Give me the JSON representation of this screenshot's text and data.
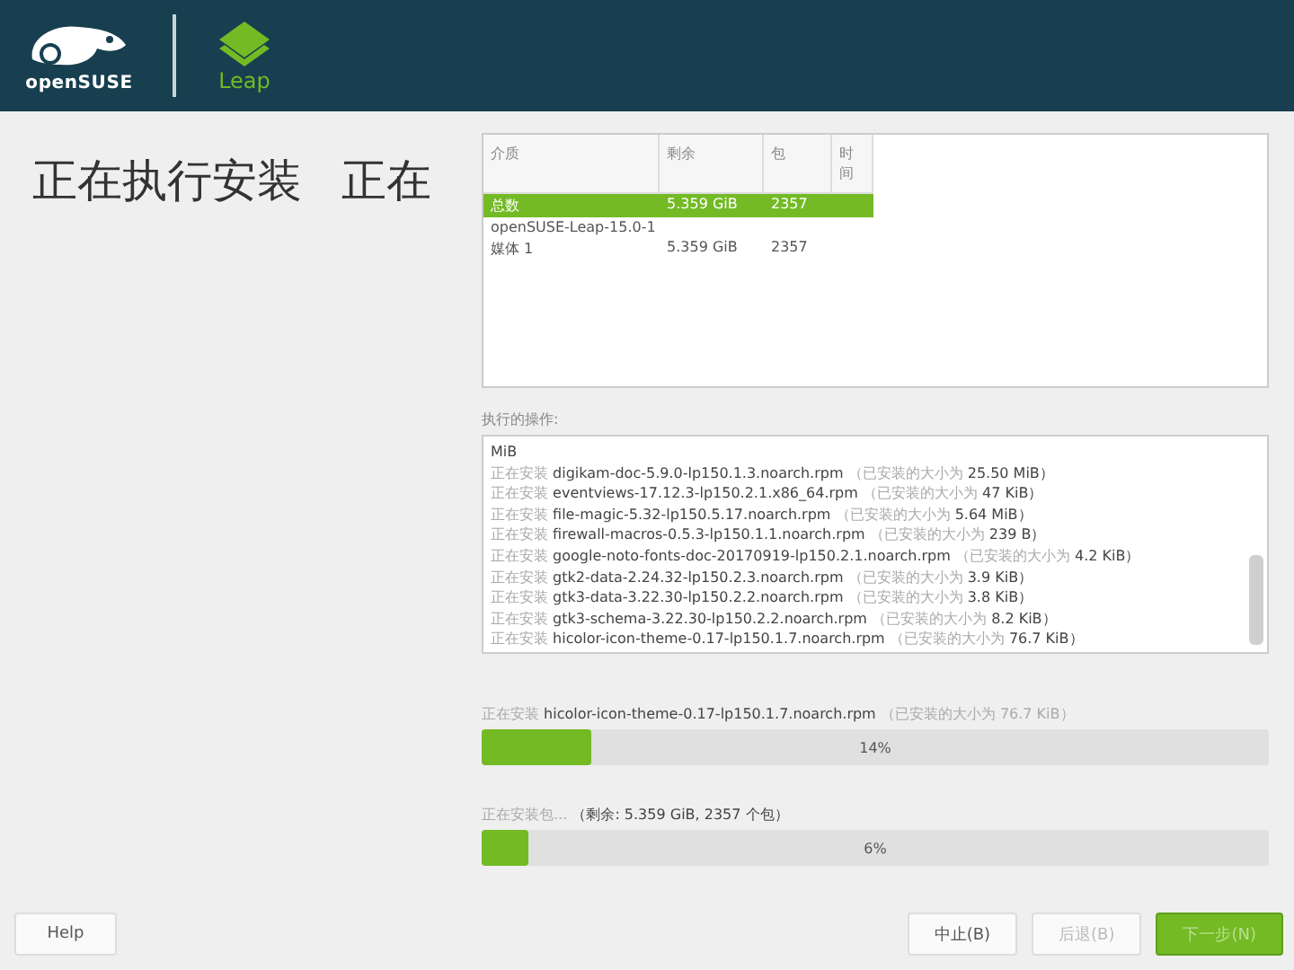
{
  "header": {
    "brand": "openSUSE",
    "product": "Leap"
  },
  "title": {
    "main": "正在执行安装",
    "secondary": "正在"
  },
  "media_table": {
    "columns": [
      "介质",
      "剩余",
      "包",
      "时间"
    ],
    "rows": [
      {
        "cells": [
          "总数",
          "5.359 GiB",
          "2357",
          ""
        ],
        "selected": true
      },
      {
        "cells": [
          "openSUSE-Leap-15.0-1",
          "",
          "",
          ""
        ],
        "selected": false
      },
      {
        "cells": [
          "媒体 1",
          "5.359 GiB",
          "2357",
          ""
        ],
        "selected": false
      }
    ]
  },
  "log": {
    "label": "执行的操作:",
    "lines": [
      {
        "kind": "plain",
        "text": "MiB"
      },
      {
        "kind": "install",
        "action": "正在安装",
        "package": "digikam-doc-5.9.0-lp150.1.3.noarch.rpm",
        "note": "（已安装的大小为",
        "size": "25.50 MiB）"
      },
      {
        "kind": "install",
        "action": "正在安装",
        "package": "eventviews-17.12.3-lp150.2.1.x86_64.rpm",
        "note": "（已安装的大小为",
        "size": "47 KiB）"
      },
      {
        "kind": "install",
        "action": "正在安装",
        "package": "file-magic-5.32-lp150.5.17.noarch.rpm",
        "note": "（已安装的大小为",
        "size": "5.64 MiB）"
      },
      {
        "kind": "install",
        "action": "正在安装",
        "package": "firewall-macros-0.5.3-lp150.1.1.noarch.rpm",
        "note": "（已安装的大小为",
        "size": "239 B）"
      },
      {
        "kind": "install",
        "action": "正在安装",
        "package": "google-noto-fonts-doc-20170919-lp150.2.1.noarch.rpm",
        "note": "（已安装的大小为",
        "size": "4.2 KiB）"
      },
      {
        "kind": "install",
        "action": "正在安装",
        "package": "gtk2-data-2.24.32-lp150.2.3.noarch.rpm",
        "note": "（已安装的大小为",
        "size": "3.9 KiB）"
      },
      {
        "kind": "install",
        "action": "正在安装",
        "package": "gtk3-data-3.22.30-lp150.2.2.noarch.rpm",
        "note": "（已安装的大小为",
        "size": "3.8 KiB）"
      },
      {
        "kind": "install",
        "action": "正在安装",
        "package": "gtk3-schema-3.22.30-lp150.2.2.noarch.rpm",
        "note": "（已安装的大小为",
        "size": "8.2 KiB）"
      },
      {
        "kind": "install",
        "action": "正在安装",
        "package": "hicolor-icon-theme-0.17-lp150.1.7.noarch.rpm",
        "note": "（已安装的大小为",
        "size": "76.7 KiB）"
      }
    ]
  },
  "progress": [
    {
      "action": "正在安装",
      "subject": "hicolor-icon-theme-0.17-lp150.1.7.noarch.rpm",
      "note": "（已安装的大小为 76.7 KiB）",
      "level": 0.14,
      "reading": "14%"
    },
    {
      "action": "正在安装包...",
      "subject": "（剩余: 5.359 GiB, 2357 个包）",
      "level": 0.06,
      "reading": "6%"
    }
  ],
  "buttons": [
    {
      "label": "Help",
      "kind": "plain",
      "disabled": false
    },
    {
      "label": "中止(B)",
      "kind": "plain",
      "disabled": false
    },
    {
      "label": "后退(B)",
      "kind": "plain",
      "disabled": true
    },
    {
      "label": "下一步(N)",
      "kind": "primary",
      "disabled": true
    }
  ]
}
